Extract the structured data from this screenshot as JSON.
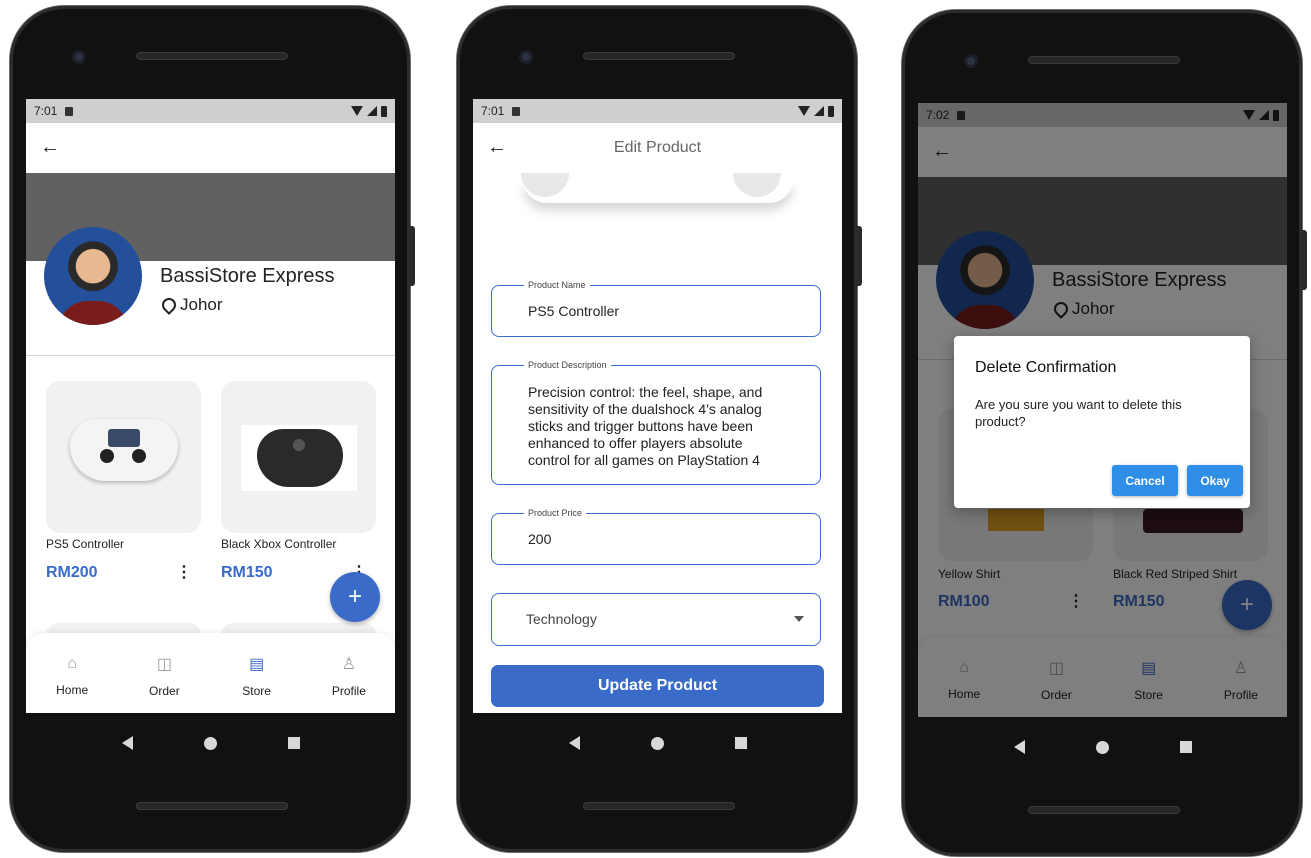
{
  "status": {
    "time1": "7:01",
    "time2": "7:01",
    "time3": "7:02"
  },
  "store": {
    "name": "BassiStore Express",
    "location": "Johor"
  },
  "products1": [
    {
      "name": "PS5 Controller",
      "price": "RM200"
    },
    {
      "name": "Black Xbox Controller",
      "price": "RM150"
    }
  ],
  "products3": [
    {
      "name": "Yellow Shirt",
      "price": "RM100"
    },
    {
      "name": "Black Red Striped Shirt",
      "price": "RM150"
    }
  ],
  "fab": {
    "icon": "+"
  },
  "nav": {
    "home": "Home",
    "order": "Order",
    "store": "Store",
    "profile": "Profile"
  },
  "edit": {
    "title": "Edit Product",
    "name_label": "Product Name",
    "name_value": "PS5 Controller",
    "desc_label": "Product Description",
    "desc_value": "Precision control: the feel, shape, and sensitivity of the dualshock 4's analog sticks and trigger buttons have been enhanced to offer players absolute control for all games on PlayStation 4",
    "price_label": "Product Price",
    "price_value": "200",
    "category_value": "Technology",
    "update_label": "Update Product"
  },
  "dialog": {
    "title": "Delete Confirmation",
    "message": "Are you sure you want to delete this product?",
    "cancel": "Cancel",
    "okay": "Okay"
  },
  "colors": {
    "accent": "#3a6bc8",
    "dialog_button": "#2f8fe8",
    "banner": "#616161"
  }
}
